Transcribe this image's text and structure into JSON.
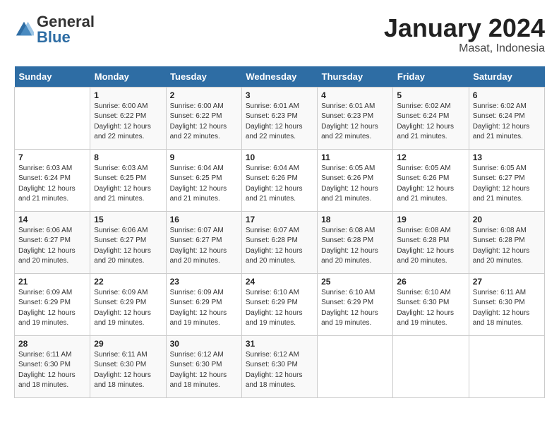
{
  "header": {
    "logo": {
      "general": "General",
      "blue": "Blue"
    },
    "title": "January 2024",
    "location": "Masat, Indonesia"
  },
  "calendar": {
    "days_of_week": [
      "Sunday",
      "Monday",
      "Tuesday",
      "Wednesday",
      "Thursday",
      "Friday",
      "Saturday"
    ],
    "weeks": [
      [
        {
          "day": "",
          "info": ""
        },
        {
          "day": "1",
          "info": "Sunrise: 6:00 AM\nSunset: 6:22 PM\nDaylight: 12 hours\nand 22 minutes."
        },
        {
          "day": "2",
          "info": "Sunrise: 6:00 AM\nSunset: 6:22 PM\nDaylight: 12 hours\nand 22 minutes."
        },
        {
          "day": "3",
          "info": "Sunrise: 6:01 AM\nSunset: 6:23 PM\nDaylight: 12 hours\nand 22 minutes."
        },
        {
          "day": "4",
          "info": "Sunrise: 6:01 AM\nSunset: 6:23 PM\nDaylight: 12 hours\nand 22 minutes."
        },
        {
          "day": "5",
          "info": "Sunrise: 6:02 AM\nSunset: 6:24 PM\nDaylight: 12 hours\nand 21 minutes."
        },
        {
          "day": "6",
          "info": "Sunrise: 6:02 AM\nSunset: 6:24 PM\nDaylight: 12 hours\nand 21 minutes."
        }
      ],
      [
        {
          "day": "7",
          "info": "Sunrise: 6:03 AM\nSunset: 6:24 PM\nDaylight: 12 hours\nand 21 minutes."
        },
        {
          "day": "8",
          "info": "Sunrise: 6:03 AM\nSunset: 6:25 PM\nDaylight: 12 hours\nand 21 minutes."
        },
        {
          "day": "9",
          "info": "Sunrise: 6:04 AM\nSunset: 6:25 PM\nDaylight: 12 hours\nand 21 minutes."
        },
        {
          "day": "10",
          "info": "Sunrise: 6:04 AM\nSunset: 6:26 PM\nDaylight: 12 hours\nand 21 minutes."
        },
        {
          "day": "11",
          "info": "Sunrise: 6:05 AM\nSunset: 6:26 PM\nDaylight: 12 hours\nand 21 minutes."
        },
        {
          "day": "12",
          "info": "Sunrise: 6:05 AM\nSunset: 6:26 PM\nDaylight: 12 hours\nand 21 minutes."
        },
        {
          "day": "13",
          "info": "Sunrise: 6:05 AM\nSunset: 6:27 PM\nDaylight: 12 hours\nand 21 minutes."
        }
      ],
      [
        {
          "day": "14",
          "info": "Sunrise: 6:06 AM\nSunset: 6:27 PM\nDaylight: 12 hours\nand 20 minutes."
        },
        {
          "day": "15",
          "info": "Sunrise: 6:06 AM\nSunset: 6:27 PM\nDaylight: 12 hours\nand 20 minutes."
        },
        {
          "day": "16",
          "info": "Sunrise: 6:07 AM\nSunset: 6:27 PM\nDaylight: 12 hours\nand 20 minutes."
        },
        {
          "day": "17",
          "info": "Sunrise: 6:07 AM\nSunset: 6:28 PM\nDaylight: 12 hours\nand 20 minutes."
        },
        {
          "day": "18",
          "info": "Sunrise: 6:08 AM\nSunset: 6:28 PM\nDaylight: 12 hours\nand 20 minutes."
        },
        {
          "day": "19",
          "info": "Sunrise: 6:08 AM\nSunset: 6:28 PM\nDaylight: 12 hours\nand 20 minutes."
        },
        {
          "day": "20",
          "info": "Sunrise: 6:08 AM\nSunset: 6:28 PM\nDaylight: 12 hours\nand 20 minutes."
        }
      ],
      [
        {
          "day": "21",
          "info": "Sunrise: 6:09 AM\nSunset: 6:29 PM\nDaylight: 12 hours\nand 19 minutes."
        },
        {
          "day": "22",
          "info": "Sunrise: 6:09 AM\nSunset: 6:29 PM\nDaylight: 12 hours\nand 19 minutes."
        },
        {
          "day": "23",
          "info": "Sunrise: 6:09 AM\nSunset: 6:29 PM\nDaylight: 12 hours\nand 19 minutes."
        },
        {
          "day": "24",
          "info": "Sunrise: 6:10 AM\nSunset: 6:29 PM\nDaylight: 12 hours\nand 19 minutes."
        },
        {
          "day": "25",
          "info": "Sunrise: 6:10 AM\nSunset: 6:29 PM\nDaylight: 12 hours\nand 19 minutes."
        },
        {
          "day": "26",
          "info": "Sunrise: 6:10 AM\nSunset: 6:30 PM\nDaylight: 12 hours\nand 19 minutes."
        },
        {
          "day": "27",
          "info": "Sunrise: 6:11 AM\nSunset: 6:30 PM\nDaylight: 12 hours\nand 18 minutes."
        }
      ],
      [
        {
          "day": "28",
          "info": "Sunrise: 6:11 AM\nSunset: 6:30 PM\nDaylight: 12 hours\nand 18 minutes."
        },
        {
          "day": "29",
          "info": "Sunrise: 6:11 AM\nSunset: 6:30 PM\nDaylight: 12 hours\nand 18 minutes."
        },
        {
          "day": "30",
          "info": "Sunrise: 6:12 AM\nSunset: 6:30 PM\nDaylight: 12 hours\nand 18 minutes."
        },
        {
          "day": "31",
          "info": "Sunrise: 6:12 AM\nSunset: 6:30 PM\nDaylight: 12 hours\nand 18 minutes."
        },
        {
          "day": "",
          "info": ""
        },
        {
          "day": "",
          "info": ""
        },
        {
          "day": "",
          "info": ""
        }
      ]
    ]
  }
}
